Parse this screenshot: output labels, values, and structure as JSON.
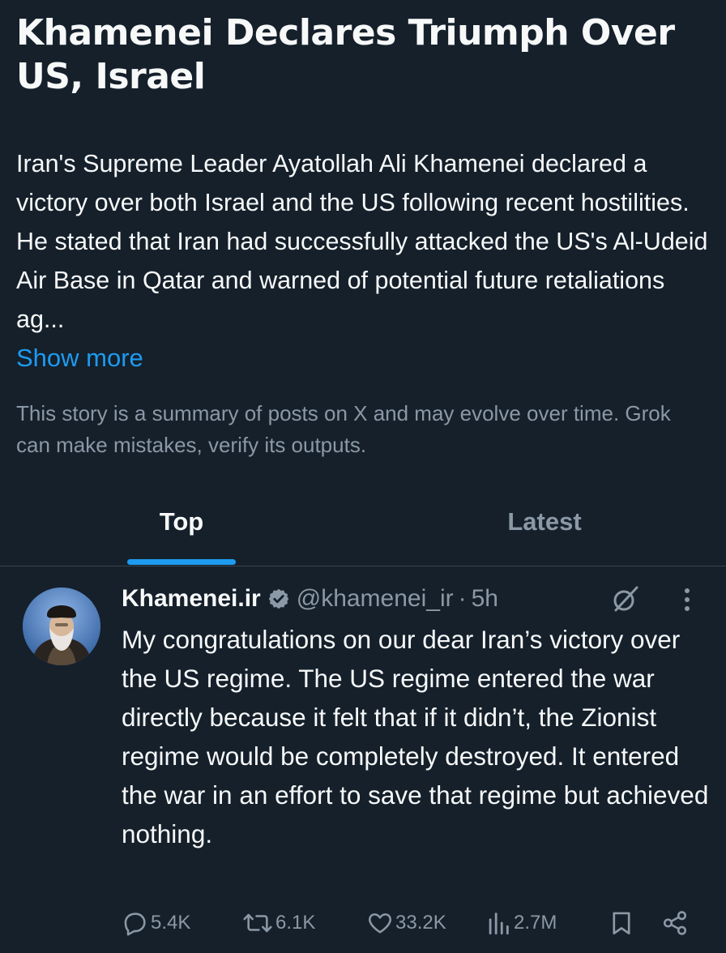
{
  "story": {
    "headline": "Khamenei Declares Triumph Over US, Israel",
    "summary": "Iran's Supreme Leader Ayatollah Ali Khamenei declared a victory over both Israel and the US following recent hostilities. He stated that Iran had successfully attacked the US's Al-Udeid Air Base in Qatar and warned of potential future retaliations ag...",
    "show_more": "Show more",
    "disclaimer": "This story is a summary of posts on X and may evolve over time. Grok can make mistakes, verify its outputs."
  },
  "tabs": [
    {
      "label": "Top",
      "active": true
    },
    {
      "label": "Latest",
      "active": false
    }
  ],
  "post": {
    "display_name": "Khamenei.ir",
    "handle": "@khamenei_ir",
    "separator": "·",
    "time": "5h",
    "text": "My congratulations on our dear Iran’s victory over the US regime. The US regime entered the war directly because it felt that if it didn’t, the Zionist regime would be completely destroyed. It entered the war in an effort to save that regime but achieved nothing.",
    "actions": {
      "replies": "5.4K",
      "reposts": "6.1K",
      "likes": "33.2K",
      "views": "2.7M"
    }
  },
  "icons": {
    "verified": "verified-badge-icon",
    "grok": "grok-icon",
    "more": "more-vertical-icon",
    "reply": "reply-icon",
    "repost": "repost-icon",
    "like": "heart-icon",
    "views": "views-chart-icon",
    "bookmark": "bookmark-icon",
    "share": "share-icon"
  },
  "colors": {
    "background": "#15202b",
    "text": "#f7f9f9",
    "muted": "#8b98a5",
    "accent": "#1d9bf0",
    "divider": "#38444d"
  }
}
